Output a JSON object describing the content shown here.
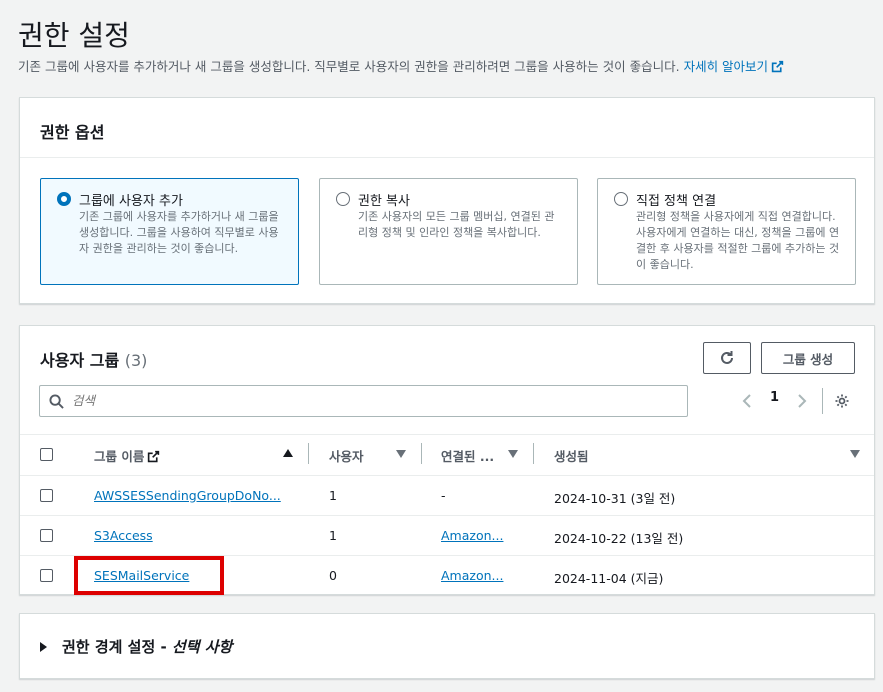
{
  "page": {
    "title": "권한 설정",
    "description": "기존 그룹에 사용자를 추가하거나 새 그룹을 생성합니다. 직무별로 사용자의 권한을 관리하려면 그룹을 사용하는 것이 좋습니다.",
    "learn_more": "자세히 알아보기"
  },
  "options": {
    "title": "권한 옵션",
    "tiles": [
      {
        "title": "그룹에 사용자 추가",
        "desc": "기존 그룹에 사용자를 추가하거나 새 그룹을 생성합니다. 그룹을 사용하여 직무별로 사용자 권한을 관리하는 것이 좋습니다.",
        "selected": true
      },
      {
        "title": "권한 복사",
        "desc": "기존 사용자의 모든 그룹 멤버십, 연결된 관리형 정책 및 인라인 정책을 복사합니다.",
        "selected": false
      },
      {
        "title": "직접 정책 연결",
        "desc": "관리형 정책을 사용자에게 직접 연결합니다. 사용자에게 연결하는 대신, 정책을 그룹에 연결한 후 사용자를 적절한 그룹에 추가하는 것이 좋습니다.",
        "selected": false
      }
    ]
  },
  "groups": {
    "title": "사용자 그룹",
    "count": "(3)",
    "create_label": "그룹 생성",
    "search_placeholder": "검색",
    "page": "1",
    "columns": {
      "name": "그룹 이름",
      "users": "사용자",
      "attached": "연결된 ...",
      "created": "생성됨"
    },
    "rows": [
      {
        "name": "AWSSESSendingGroupDoNo...",
        "users": "1",
        "attached": "-",
        "created": "2024-10-31 (3일 전)"
      },
      {
        "name": "S3Access",
        "users": "1",
        "attached": "Amazon...",
        "created": "2024-10-22 (13일 전)"
      },
      {
        "name": "SESMailService",
        "users": "0",
        "attached": "Amazon...",
        "created": "2024-11-04 (지금)"
      }
    ]
  },
  "boundary": {
    "title": "권한 경계 설정 - ",
    "optional": "선택 사항"
  },
  "colors": {
    "accent": "#0073bb",
    "highlight": "#dd0000"
  }
}
